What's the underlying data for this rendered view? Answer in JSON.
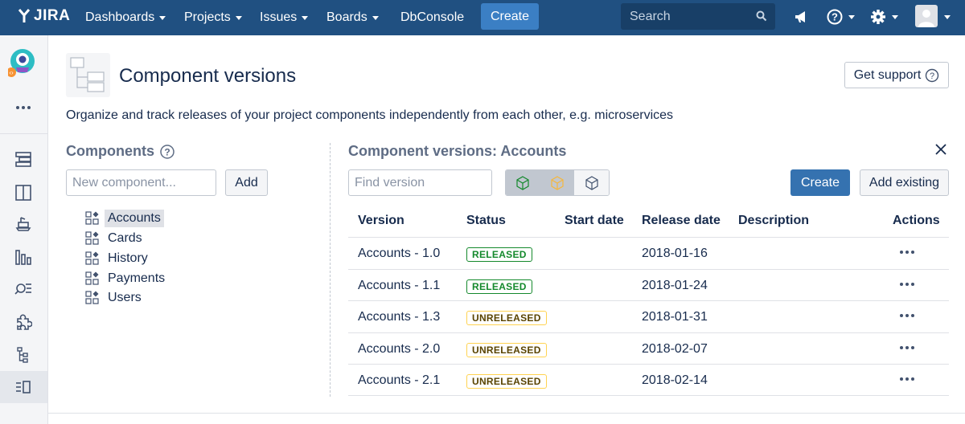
{
  "topnav": {
    "logo": "JIRA",
    "items": [
      "Dashboards",
      "Projects",
      "Issues",
      "Boards",
      "DbConsole"
    ],
    "create_label": "Create",
    "search_placeholder": "Search",
    "icons": [
      "megaphone-icon",
      "help-icon",
      "gear-icon",
      "avatar"
    ]
  },
  "sidebar": {
    "icons": [
      "project-avatar",
      "more-icon",
      "backlog-icon",
      "board-icon",
      "releases-icon",
      "reports-icon",
      "search-issues-icon",
      "add-ons-icon",
      "components-icon",
      "component-versions-icon"
    ]
  },
  "header": {
    "title": "Component versions",
    "support_label": "Get support",
    "description": "Organize and track releases of your project components independently from each other, e.g. microservices"
  },
  "components": {
    "title": "Components",
    "new_placeholder": "New component...",
    "add_label": "Add",
    "items": [
      "Accounts",
      "Cards",
      "History",
      "Payments",
      "Users"
    ],
    "selected": "Accounts"
  },
  "versions": {
    "title": "Component versions: Accounts",
    "find_placeholder": "Find version",
    "create_label": "Create",
    "add_existing_label": "Add existing",
    "columns": [
      "Version",
      "Status",
      "Start date",
      "Release date",
      "Description",
      "Actions"
    ],
    "rows": [
      {
        "version": "Accounts - 1.0",
        "status": "RELEASED",
        "start": "",
        "release": "2018-01-16",
        "description": ""
      },
      {
        "version": "Accounts - 1.1",
        "status": "RELEASED",
        "start": "",
        "release": "2018-01-24",
        "description": ""
      },
      {
        "version": "Accounts - 1.3",
        "status": "UNRELEASED",
        "start": "",
        "release": "2018-01-31",
        "description": ""
      },
      {
        "version": "Accounts - 2.0",
        "status": "UNRELEASED",
        "start": "",
        "release": "2018-02-07",
        "description": ""
      },
      {
        "version": "Accounts - 2.1",
        "status": "UNRELEASED",
        "start": "",
        "release": "2018-02-14",
        "description": ""
      }
    ]
  },
  "colors": {
    "nav_bg": "#205081",
    "primary": "#3572b0",
    "released": "#14892c",
    "unreleased_border": "#ffd351"
  }
}
